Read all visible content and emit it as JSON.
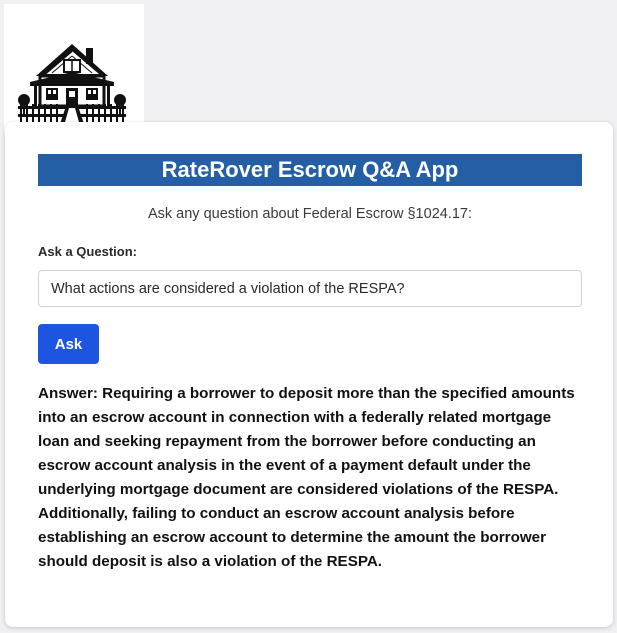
{
  "logo": {
    "icon": "house-icon"
  },
  "app": {
    "title": "RateRover Escrow Q&A App",
    "subtitle": "Ask any question about Federal Escrow §1024.17:"
  },
  "question": {
    "label": "Ask a Question:",
    "value": "What actions are considered a violation of the RESPA?",
    "placeholder": ""
  },
  "ask_button": {
    "label": "Ask"
  },
  "answer": {
    "text": "Answer: Requiring a borrower to deposit more than the specified amounts into an escrow account in connection with a federally related mortgage loan and seeking repayment from the borrower before conducting an escrow account analysis in the event of a payment default under the underlying mortgage document are considered violations of the RESPA. Additionally, failing to conduct an escrow account analysis before establishing an escrow account to determine the amount the borrower should deposit is also a violation of the RESPA."
  },
  "colors": {
    "title_bar": "#245fa6",
    "ask_button": "#1e55e0"
  }
}
